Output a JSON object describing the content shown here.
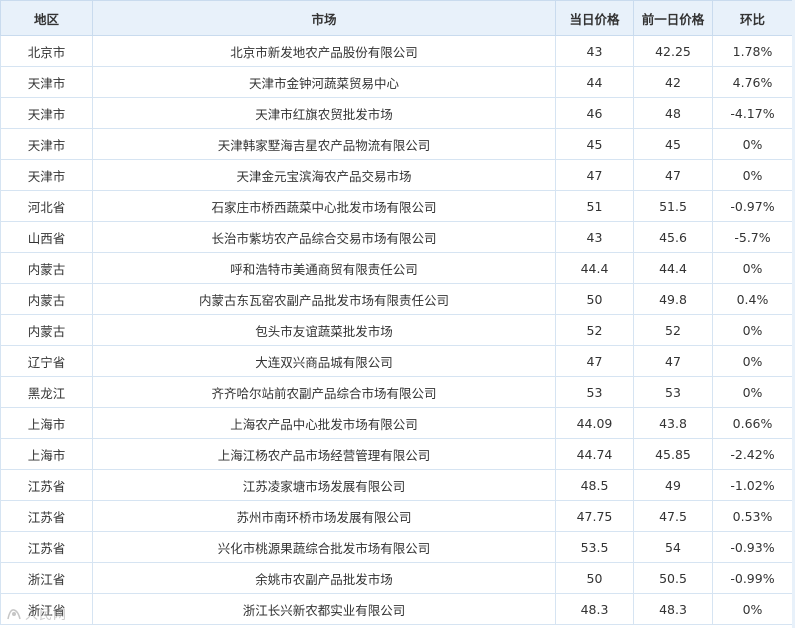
{
  "table": {
    "headers": [
      "地区",
      "市场",
      "当日价格",
      "前一日价格",
      "环比"
    ],
    "rows": [
      [
        "北京市",
        "北京市新发地农产品股份有限公司",
        "43",
        "42.25",
        "1.78%"
      ],
      [
        "天津市",
        "天津市金钟河蔬菜贸易中心",
        "44",
        "42",
        "4.76%"
      ],
      [
        "天津市",
        "天津市红旗农贸批发市场",
        "46",
        "48",
        "-4.17%"
      ],
      [
        "天津市",
        "天津韩家墅海吉星农产品物流有限公司",
        "45",
        "45",
        "0%"
      ],
      [
        "天津市",
        "天津金元宝滨海农产品交易市场",
        "47",
        "47",
        "0%"
      ],
      [
        "河北省",
        "石家庄市桥西蔬菜中心批发市场有限公司",
        "51",
        "51.5",
        "-0.97%"
      ],
      [
        "山西省",
        "长治市紫坊农产品综合交易市场有限公司",
        "43",
        "45.6",
        "-5.7%"
      ],
      [
        "内蒙古",
        "呼和浩特市美通商贸有限责任公司",
        "44.4",
        "44.4",
        "0%"
      ],
      [
        "内蒙古",
        "内蒙古东瓦窑农副产品批发市场有限责任公司",
        "50",
        "49.8",
        "0.4%"
      ],
      [
        "内蒙古",
        "包头市友谊蔬菜批发市场",
        "52",
        "52",
        "0%"
      ],
      [
        "辽宁省",
        "大连双兴商品城有限公司",
        "47",
        "47",
        "0%"
      ],
      [
        "黑龙江",
        "齐齐哈尔站前农副产品综合市场有限公司",
        "53",
        "53",
        "0%"
      ],
      [
        "上海市",
        "上海农产品中心批发市场有限公司",
        "44.09",
        "43.8",
        "0.66%"
      ],
      [
        "上海市",
        "上海江杨农产品市场经营管理有限公司",
        "44.74",
        "45.85",
        "-2.42%"
      ],
      [
        "江苏省",
        "江苏凌家塘市场发展有限公司",
        "48.5",
        "49",
        "-1.02%"
      ],
      [
        "江苏省",
        "苏州市南环桥市场发展有限公司",
        "47.75",
        "47.5",
        "0.53%"
      ],
      [
        "江苏省",
        "兴化市桃源果蔬综合批发市场有限公司",
        "53.5",
        "54",
        "-0.93%"
      ],
      [
        "浙江省",
        "余姚市农副产品批发市场",
        "50",
        "50.5",
        "-0.99%"
      ],
      [
        "浙江省",
        "浙江长兴新农都实业有限公司",
        "48.3",
        "48.3",
        "0%"
      ]
    ]
  },
  "watermark": {
    "icon": "logo-icon",
    "text": "人民网"
  },
  "colors": {
    "header_bg": "#e8f1fa",
    "border": "#d6e4f2",
    "text": "#333333"
  }
}
